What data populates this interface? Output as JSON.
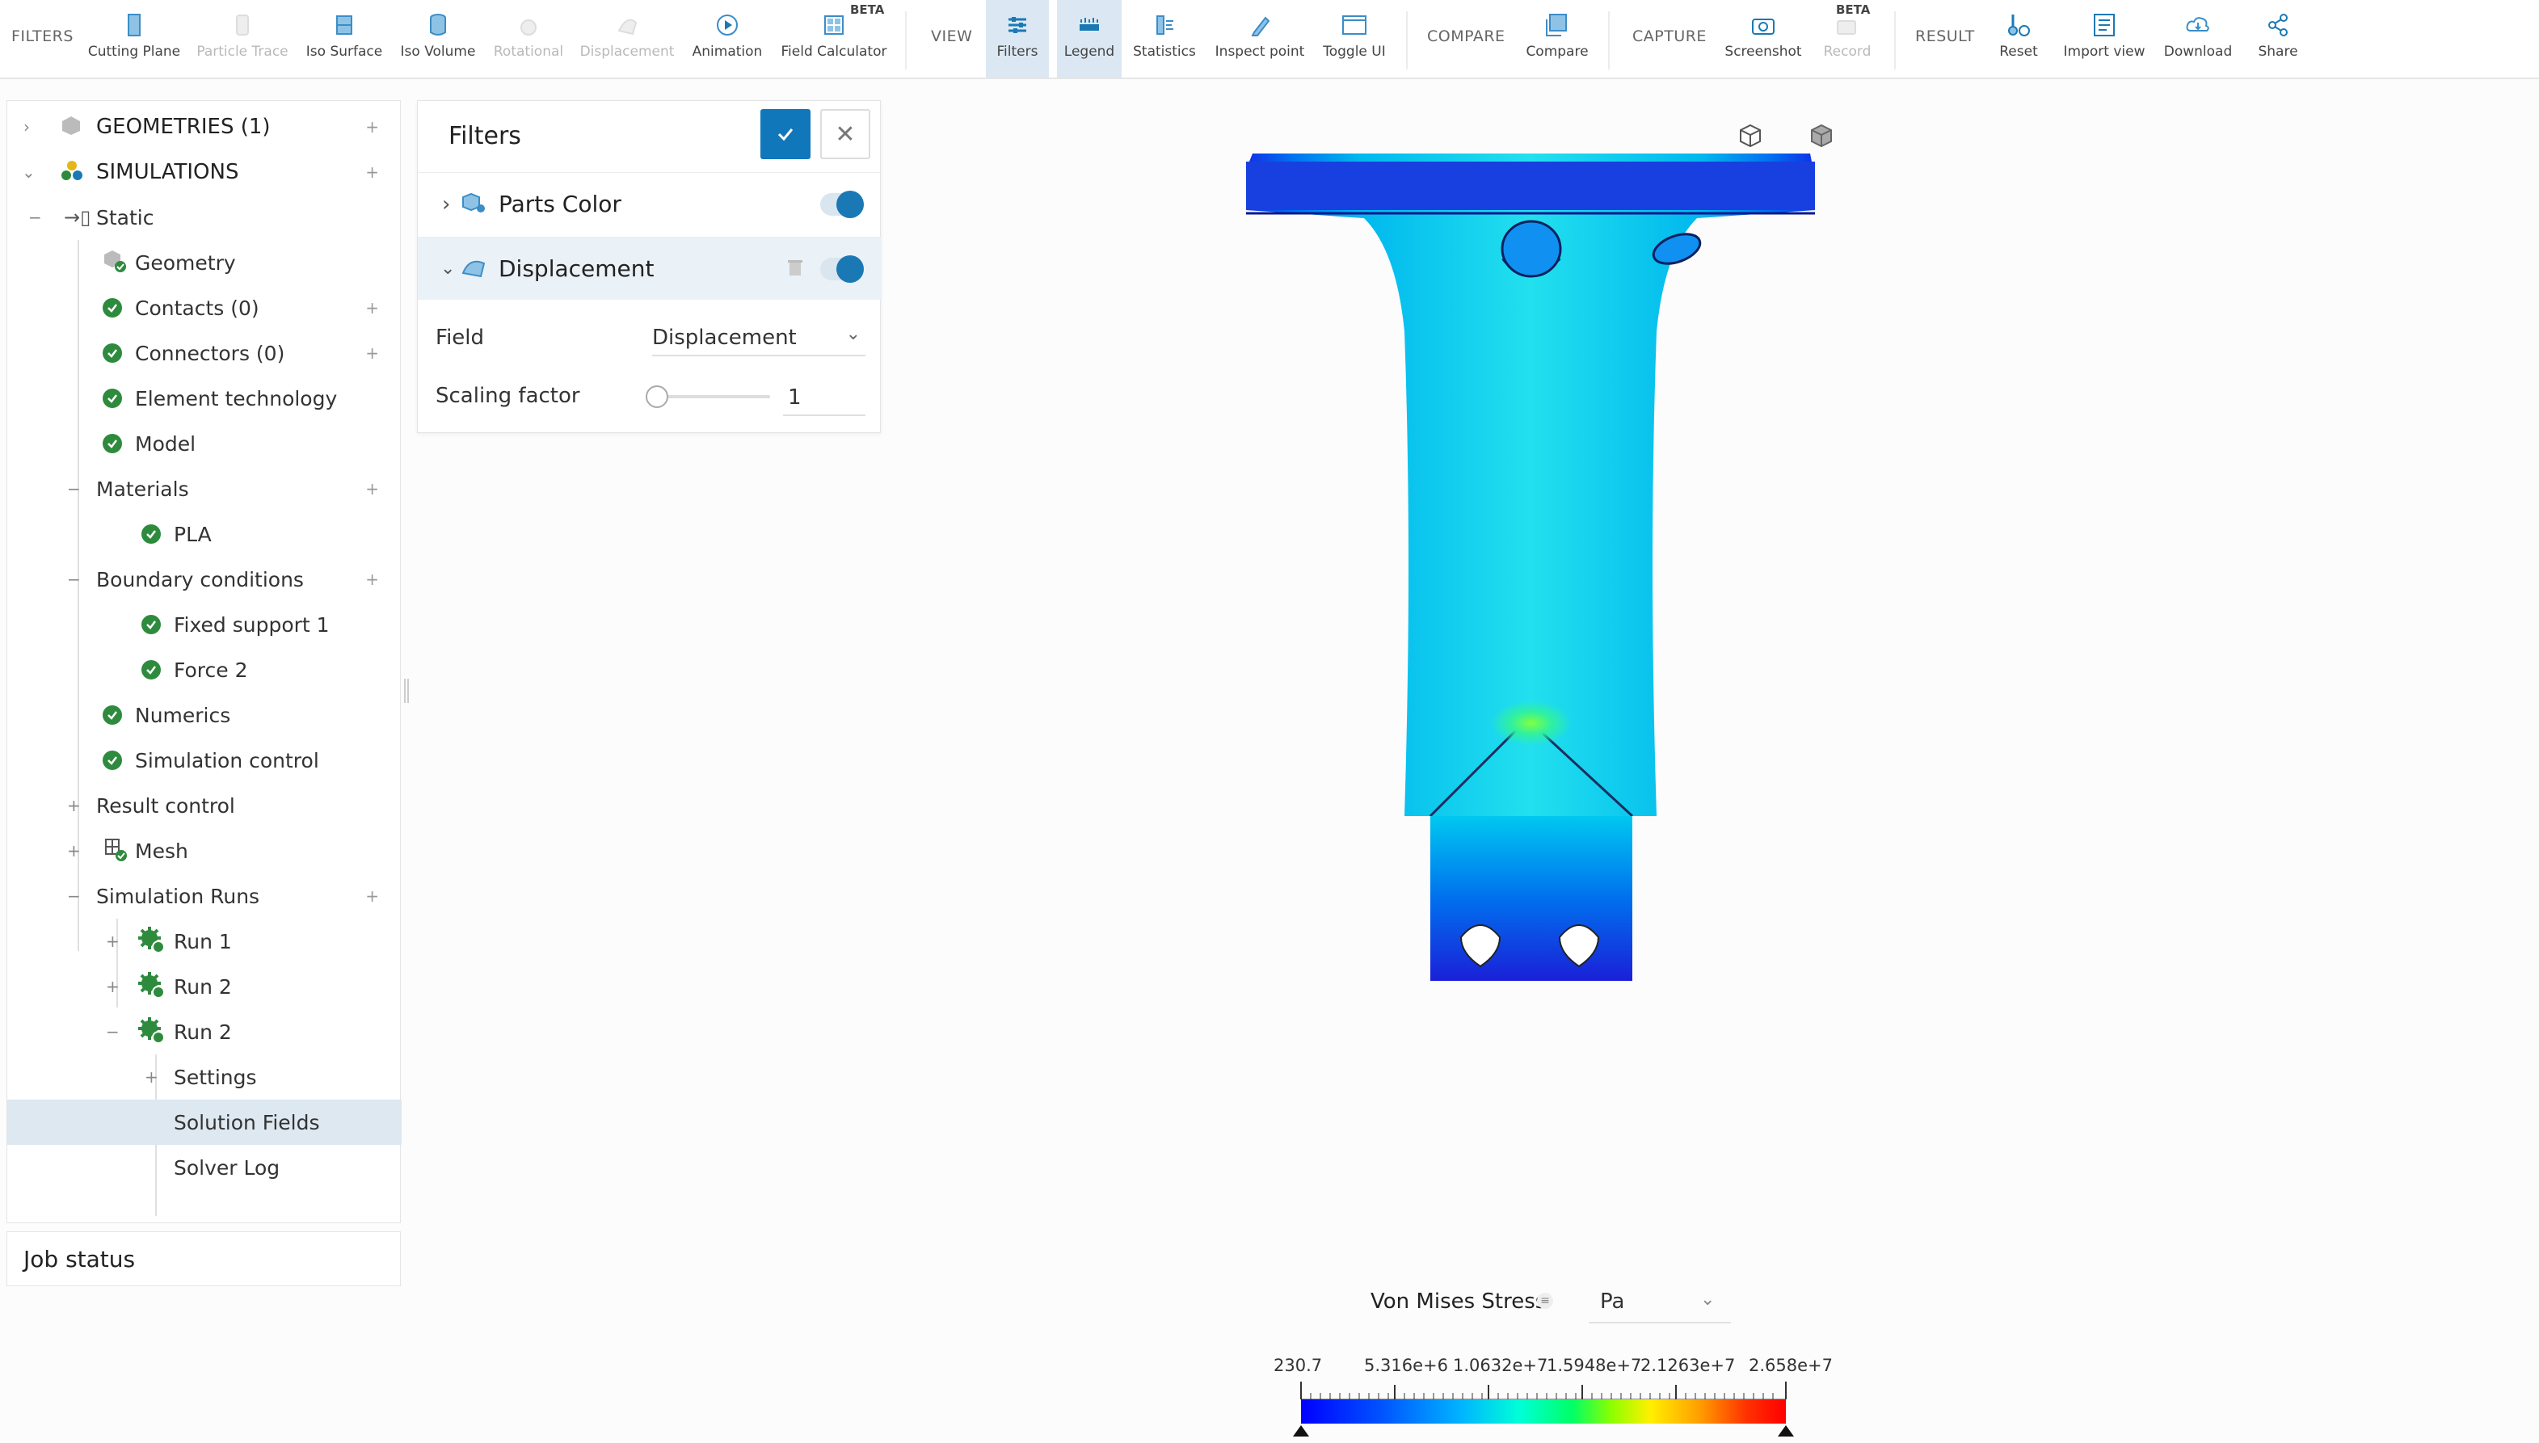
{
  "toolbar": {
    "filters_group": "FILTERS",
    "view_group": "VIEW",
    "compare_group": "COMPARE",
    "capture_group": "CAPTURE",
    "result_group": "RESULT",
    "beta": "BETA",
    "buttons": {
      "cutting_plane": "Cutting Plane",
      "particle_trace": "Particle Trace",
      "iso_surface": "Iso Surface",
      "iso_volume": "Iso Volume",
      "rotational": "Rotational",
      "displacement": "Displacement",
      "animation": "Animation",
      "field_calculator": "Field Calculator",
      "filters": "Filters",
      "legend": "Legend",
      "statistics": "Statistics",
      "inspect_point": "Inspect point",
      "toggle_ui": "Toggle UI",
      "compare": "Compare",
      "screenshot": "Screenshot",
      "record": "Record",
      "reset": "Reset",
      "import_view": "Import view",
      "download": "Download",
      "share": "Share"
    },
    "accent_color": "#1a79b5"
  },
  "tree": {
    "geometries": "GEOMETRIES (1)",
    "simulations": "SIMULATIONS",
    "static": "Static",
    "geometry": "Geometry",
    "contacts": "Contacts (0)",
    "connectors": "Connectors (0)",
    "element_technology": "Element technology",
    "model": "Model",
    "materials": "Materials",
    "pla": "PLA",
    "boundary_conditions": "Boundary conditions",
    "fixed_support": "Fixed support 1",
    "force": "Force 2",
    "numerics": "Numerics",
    "simulation_control": "Simulation control",
    "result_control": "Result control",
    "mesh": "Mesh",
    "simulation_runs": "Simulation Runs",
    "run1": "Run 1",
    "run2a": "Run 2",
    "run2b": "Run 2",
    "settings": "Settings",
    "solution_fields": "Solution Fields",
    "solver_log": "Solver Log"
  },
  "job_status": "Job status",
  "filters_panel": {
    "title": "Filters",
    "parts_color": "Parts Color",
    "displacement": "Displacement",
    "field_label": "Field",
    "field_value": "Displacement",
    "scaling_label": "Scaling factor",
    "scaling_value": "1"
  },
  "legend": {
    "title": "Von Mises Stress",
    "unit": "Pa",
    "ticks": [
      "230.7",
      "5.316e+6",
      "1.0632e+7",
      "1.5948e+7",
      "2.1263e+7",
      "2.658e+7"
    ]
  }
}
